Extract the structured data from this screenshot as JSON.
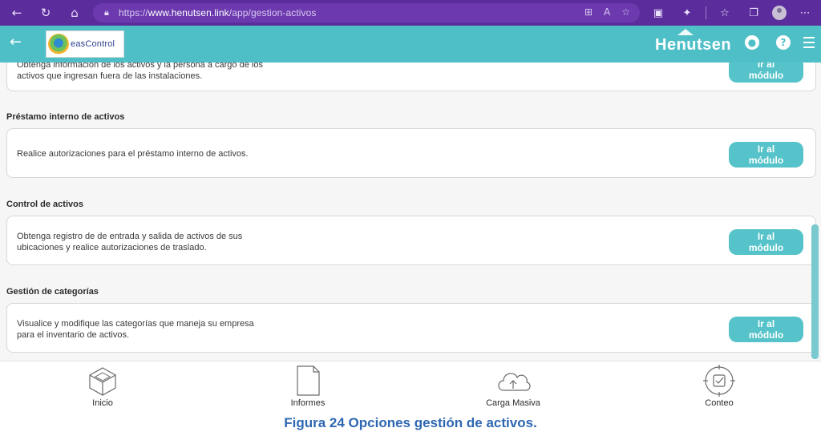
{
  "browser": {
    "url_prefix": "https://",
    "url_host": "www.henutsen.link",
    "url_path": "/app/gestion-activos",
    "icons": [
      "back-icon",
      "reload-icon",
      "home-icon",
      "lock-icon",
      "apps-icon",
      "read-aloud-icon",
      "favorite-add-icon",
      "extensions-icon",
      "favorites-icon",
      "collections-icon",
      "profile-icon",
      "more-icon"
    ]
  },
  "header": {
    "logo_text": "easControl",
    "brand": "Henutsen",
    "user_glyph": "●",
    "help_glyph": "?",
    "colors": {
      "bar": "#4fbfc7",
      "button": "#55c3c9"
    }
  },
  "sections": [
    {
      "title": "",
      "description_lines": [
        "Obtenga información de los activos y la persona a cargo de los",
        "activos que ingresan fuera de las  instalaciones."
      ],
      "button_lines": [
        "Ir al",
        "módulo"
      ]
    },
    {
      "title": "Préstamo interno de activos",
      "description_lines": [
        "Realice autorizaciones para el préstamo interno  de activos."
      ],
      "button_lines": [
        "Ir al",
        "módulo"
      ]
    },
    {
      "title": "Control de activos",
      "description_lines": [
        "Obtenga registro de de entrada y salida de activos de sus",
        "ubicaciones y realice autorizaciones de traslado."
      ],
      "button_lines": [
        "Ir al",
        "módulo"
      ]
    },
    {
      "title": "Gestión de categorías",
      "description_lines": [
        "Visualice y modifique las categorías que maneja su empresa",
        "para el inventario de activos."
      ],
      "button_lines": [
        "Ir al",
        "módulo"
      ]
    }
  ],
  "bottom_nav": [
    {
      "label": "Inicio",
      "icon": "home-cube-icon"
    },
    {
      "label": "Informes",
      "icon": "document-icon"
    },
    {
      "label": "Carga Masiva",
      "icon": "cloud-upload-icon"
    },
    {
      "label": "Conteo",
      "icon": "target-icon"
    }
  ],
  "caption": "Figura 24 Opciones gestión de activos."
}
